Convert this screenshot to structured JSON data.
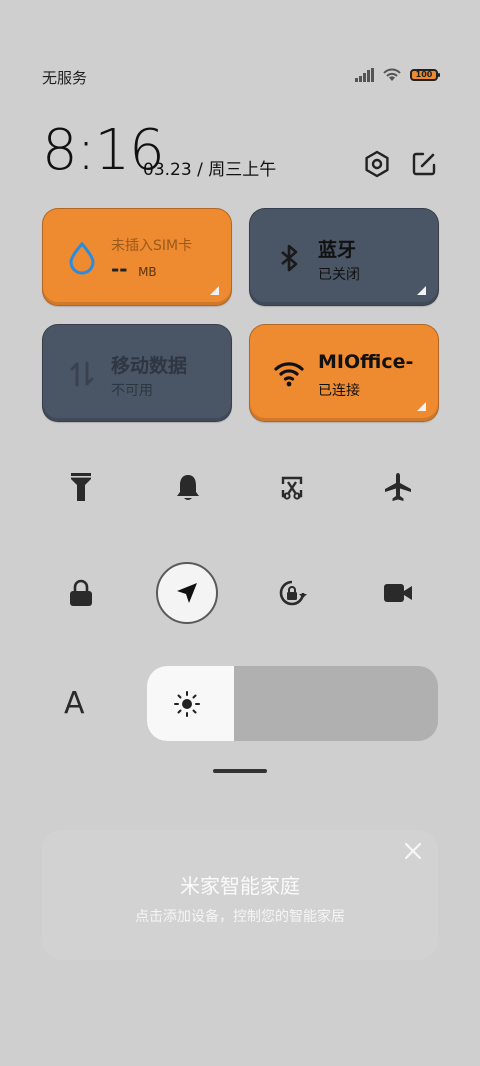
{
  "status": {
    "carrier": "无服务",
    "battery_level": "100"
  },
  "header": {
    "time": "8:16",
    "date": "03.23 / 周三上午"
  },
  "tiles": [
    {
      "title": "未插入SIM卡",
      "value": "--",
      "unit": "MB",
      "color": "#ee8a30"
    },
    {
      "title": "蓝牙",
      "sub": "已关闭",
      "color": "#4a5566"
    },
    {
      "title": "移动数据",
      "sub": "不可用",
      "color": "#4a5566"
    },
    {
      "title": "MIOffice-",
      "sub": "已连接",
      "color": "#ee8a30"
    }
  ],
  "quick_toggles": [
    {
      "icon": "flashlight-icon"
    },
    {
      "icon": "bell-icon"
    },
    {
      "icon": "screenshot-icon"
    },
    {
      "icon": "airplane-icon"
    },
    {
      "icon": "lock-icon"
    },
    {
      "icon": "location-icon",
      "active": true
    },
    {
      "icon": "rotation-lock-icon"
    },
    {
      "icon": "video-camera-icon"
    }
  ],
  "brightness": {
    "auto_label": "A",
    "level_fraction": 0.3
  },
  "mijia": {
    "title": "米家智能家庭",
    "subtitle": "点击添加设备，控制您的智能家居"
  }
}
